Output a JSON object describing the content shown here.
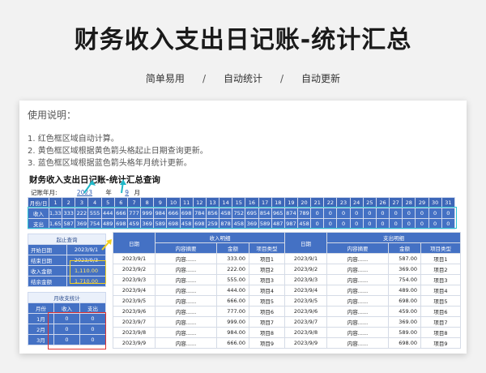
{
  "title": "财务收入支出日记账-统计汇总",
  "subtitle": [
    "简单易用",
    "自动统计",
    "自动更新"
  ],
  "subtitle_sep": "/",
  "usage": {
    "title": "使用说明：",
    "lines": [
      "1. 红色框区域自动计算。",
      "2. 黄色框区域根据黄色箭头格起止日期查询更新。",
      "3. 蓝色框区域根据蓝色箭头格年月统计更新。"
    ]
  },
  "ledger": {
    "title": "财务收入支出日记账-统计汇总查询",
    "year_label": "记账年月:",
    "year": "2023",
    "year_unit": "年",
    "month": "9",
    "month_unit": "月"
  },
  "day_grid": {
    "header_label": "月份/日",
    "days": [
      "1",
      "2",
      "3",
      "4",
      "5",
      "6",
      "7",
      "8",
      "9",
      "10",
      "11",
      "12",
      "13",
      "14",
      "15",
      "16",
      "17",
      "18",
      "19",
      "20",
      "21",
      "22",
      "23",
      "24",
      "25",
      "26",
      "27",
      "28",
      "29",
      "30",
      "31"
    ],
    "rows": [
      {
        "label": "收入",
        "values": [
          "1,3371",
          "333",
          "222",
          "555",
          "444",
          "666",
          "777",
          "999",
          "984",
          "666",
          "698",
          "784",
          "856",
          "458",
          "752",
          "695",
          "854",
          "965",
          "874",
          "789",
          "0",
          "0",
          "0",
          "0",
          "0",
          "0",
          "0",
          "0",
          "0",
          "0",
          "0"
        ]
      },
      {
        "label": "支出",
        "values": [
          "1,653",
          "587",
          "369",
          "754",
          "489",
          "698",
          "459",
          "369",
          "589",
          "698",
          "458",
          "698",
          "259",
          "878",
          "458",
          "369",
          "589",
          "487",
          "987",
          "458",
          "0",
          "0",
          "0",
          "0",
          "0",
          "0",
          "0",
          "0",
          "0",
          "0",
          "0"
        ]
      }
    ]
  },
  "query": {
    "header": "起止查询",
    "rows": [
      {
        "label": "开始日期",
        "value": "2023/9/1"
      },
      {
        "label": "结束日期",
        "value": "2023/9/3"
      },
      {
        "label": "收入金额",
        "value": "1,110.00"
      },
      {
        "label": "结余金额",
        "value": "1,710.00"
      }
    ]
  },
  "monthly": {
    "header": "月收支统计",
    "columns": [
      "月份",
      "收入",
      "支出"
    ],
    "rows": [
      [
        "1月",
        "0",
        "0"
      ],
      [
        "2月",
        "0",
        "0"
      ],
      [
        "3月",
        "0",
        "0"
      ]
    ]
  },
  "details": {
    "income_header": "收入明细",
    "expense_header": "支出明细",
    "date_label": "日期",
    "columns": [
      "内容摘要",
      "金额",
      "项目类型"
    ],
    "income_rows": [
      [
        "2023/9/1",
        "内容......",
        "333.00",
        "项目1"
      ],
      [
        "2023/9/2",
        "内容......",
        "222.00",
        "项目2"
      ],
      [
        "2023/9/3",
        "内容......",
        "555.00",
        "项目3"
      ],
      [
        "2023/9/4",
        "内容......",
        "444.00",
        "项目4"
      ],
      [
        "2023/9/5",
        "内容......",
        "666.00",
        "项目5"
      ],
      [
        "2023/9/6",
        "内容......",
        "777.00",
        "项目6"
      ],
      [
        "2023/9/7",
        "内容......",
        "999.00",
        "项目7"
      ],
      [
        "2023/9/8",
        "内容......",
        "984.00",
        "项目8"
      ],
      [
        "2023/9/9",
        "内容......",
        "666.00",
        "项目9"
      ]
    ],
    "expense_rows": [
      [
        "2023/9/1",
        "内容......",
        "587.00",
        "项目1"
      ],
      [
        "2023/9/2",
        "内容......",
        "369.00",
        "项目2"
      ],
      [
        "2023/9/3",
        "内容......",
        "754.00",
        "项目3"
      ],
      [
        "2023/9/4",
        "内容......",
        "489.00",
        "项目4"
      ],
      [
        "2023/9/5",
        "内容......",
        "698.00",
        "项目5"
      ],
      [
        "2023/9/6",
        "内容......",
        "459.00",
        "项目6"
      ],
      [
        "2023/9/7",
        "内容......",
        "369.00",
        "项目7"
      ],
      [
        "2023/9/8",
        "内容......",
        "589.00",
        "项目8"
      ],
      [
        "2023/9/9",
        "内容......",
        "698.00",
        "项目9"
      ]
    ]
  },
  "colors": {
    "header_blue": "#4471c4",
    "box_cyan": "#2cc3d4",
    "box_yellow": "#f3d020",
    "box_red": "#e03030"
  }
}
